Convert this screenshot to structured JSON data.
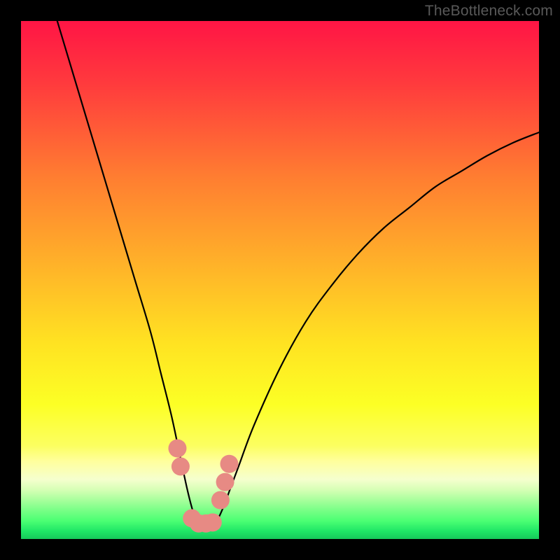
{
  "watermark": "TheBottleneck.com",
  "chart_data": {
    "type": "line",
    "title": "",
    "xlabel": "",
    "ylabel": "",
    "xlim": [
      0,
      100
    ],
    "ylim": [
      0,
      100
    ],
    "grid": false,
    "legend": false,
    "background_gradient_stops": [
      {
        "pos": 0.0,
        "color": "#ff1545"
      },
      {
        "pos": 0.12,
        "color": "#ff3a3d"
      },
      {
        "pos": 0.3,
        "color": "#ff7d31"
      },
      {
        "pos": 0.47,
        "color": "#ffb229"
      },
      {
        "pos": 0.62,
        "color": "#ffe222"
      },
      {
        "pos": 0.74,
        "color": "#fcff25"
      },
      {
        "pos": 0.82,
        "color": "#fcff60"
      },
      {
        "pos": 0.85,
        "color": "#ffff9d"
      },
      {
        "pos": 0.885,
        "color": "#f5ffce"
      },
      {
        "pos": 0.905,
        "color": "#d6ffb5"
      },
      {
        "pos": 0.925,
        "color": "#a7ff9c"
      },
      {
        "pos": 0.945,
        "color": "#77ff86"
      },
      {
        "pos": 0.965,
        "color": "#4bff73"
      },
      {
        "pos": 0.985,
        "color": "#1fe666"
      },
      {
        "pos": 1.0,
        "color": "#16c85b"
      }
    ],
    "series": [
      {
        "name": "bottleneck-curve",
        "stroke": "#000000",
        "stroke_width": 2.2,
        "x": [
          7.0,
          10.0,
          13.0,
          16.0,
          19.0,
          22.0,
          25.0,
          27.0,
          29.0,
          30.5,
          32.0,
          33.0,
          34.0,
          35.0,
          36.0,
          37.5,
          39.0,
          40.5,
          42.0,
          45.0,
          50.0,
          55.0,
          60.0,
          65.0,
          70.0,
          75.0,
          80.0,
          85.0,
          90.0,
          95.0,
          100.0
        ],
        "y": [
          100.0,
          90.0,
          80.0,
          70.0,
          60.0,
          50.0,
          40.0,
          32.0,
          24.0,
          17.0,
          10.0,
          6.0,
          3.0,
          2.0,
          2.0,
          3.0,
          6.0,
          10.0,
          14.0,
          22.0,
          33.0,
          42.0,
          49.0,
          55.0,
          60.0,
          64.0,
          68.0,
          71.0,
          74.0,
          76.5,
          78.5
        ]
      },
      {
        "name": "bottleneck-markers",
        "type": "scatter",
        "marker_color": "#e78a84",
        "marker_radius": 13,
        "x": [
          30.2,
          30.8,
          33.0,
          34.3,
          35.7,
          37.0,
          38.5,
          39.4,
          40.2
        ],
        "y": [
          17.5,
          14.0,
          4.0,
          3.0,
          3.0,
          3.2,
          7.5,
          11.0,
          14.5
        ]
      }
    ]
  }
}
